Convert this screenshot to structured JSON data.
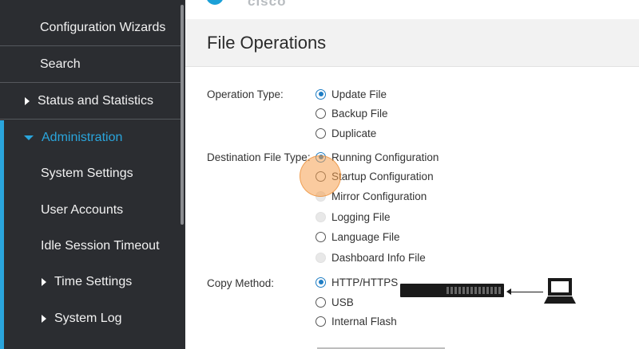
{
  "brand": {
    "logo_text": "cisco"
  },
  "sidebar": {
    "items": [
      {
        "label": "Configuration Wizards"
      },
      {
        "label": "Search"
      },
      {
        "label": "Status and Statistics"
      },
      {
        "label": "Administration"
      },
      {
        "label": "System Settings"
      },
      {
        "label": "User Accounts"
      },
      {
        "label": "Idle Session Timeout"
      },
      {
        "label": "Time Settings"
      },
      {
        "label": "System Log"
      }
    ]
  },
  "page": {
    "title": "File Operations"
  },
  "form": {
    "operation_type": {
      "label": "Operation Type:",
      "options": [
        {
          "label": "Update File",
          "state": "checked"
        },
        {
          "label": "Backup File",
          "state": "unchecked"
        },
        {
          "label": "Duplicate",
          "state": "unchecked"
        }
      ]
    },
    "destination_file_type": {
      "label": "Destination File Type:",
      "options": [
        {
          "label": "Running Configuration",
          "state": "checked"
        },
        {
          "label": "Startup Configuration",
          "state": "unchecked"
        },
        {
          "label": "Mirror Configuration",
          "state": "disabled"
        },
        {
          "label": "Logging File",
          "state": "disabled"
        },
        {
          "label": "Language File",
          "state": "unchecked"
        },
        {
          "label": "Dashboard Info File",
          "state": "disabled"
        }
      ]
    },
    "copy_method": {
      "label": "Copy Method:",
      "options": [
        {
          "label": "HTTP/HTTPS",
          "state": "checked"
        },
        {
          "label": "USB",
          "state": "unchecked"
        },
        {
          "label": "Internal Flash",
          "state": "unchecked"
        }
      ]
    }
  },
  "colors": {
    "accent": "#2aa5dc",
    "sidebar_bg": "#2b2d31",
    "radio_checked": "#1e7dc4",
    "highlight": "#f5a050"
  }
}
